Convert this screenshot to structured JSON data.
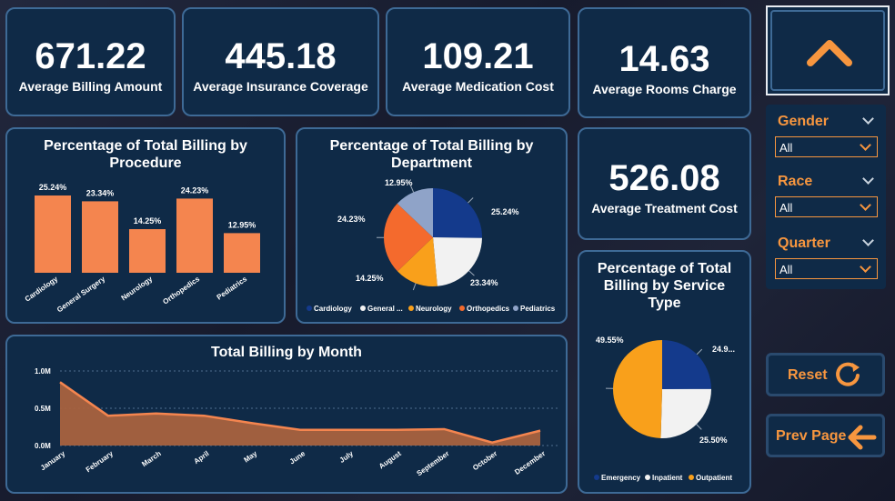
{
  "kpis": {
    "billing": {
      "value": "671.22",
      "label": "Average Billing Amount"
    },
    "insurance": {
      "value": "445.18",
      "label": "Average Insurance Coverage"
    },
    "medication": {
      "value": "109.21",
      "label": "Average Medication Cost"
    },
    "rooms": {
      "value": "14.63",
      "label": "Average Rooms Charge"
    },
    "treatment": {
      "value": "526.08",
      "label": "Average Treatment Cost"
    }
  },
  "slicers": {
    "gender": {
      "label": "Gender",
      "value": "All"
    },
    "race": {
      "label": "Race",
      "value": "All"
    },
    "quarter": {
      "label": "Quarter",
      "value": "All"
    }
  },
  "buttons": {
    "reset": "Reset",
    "prev": "Prev Page"
  },
  "colors": {
    "accent": "#f7963f",
    "card_bg": "#0f2a47",
    "bar": "#f4854f"
  },
  "chart_data": [
    {
      "id": "procedure",
      "type": "bar",
      "title": "Percentage of Total Billing by Procedure",
      "categories": [
        "Cardiology",
        "General Surgery",
        "Neurology",
        "Orthopedics",
        "Pediatrics"
      ],
      "values": [
        25.24,
        23.34,
        14.25,
        24.23,
        12.95
      ],
      "value_labels": [
        "25.24%",
        "23.34%",
        "14.25%",
        "24.23%",
        "12.95%"
      ],
      "ylim": [
        0,
        30
      ],
      "grid": false
    },
    {
      "id": "department",
      "type": "pie",
      "title": "Percentage of Total Billing by Department",
      "categories": [
        "Cardiology",
        "General ...",
        "Neurology",
        "Orthopedics",
        "Pediatrics"
      ],
      "values": [
        25.24,
        23.34,
        14.25,
        24.23,
        12.95
      ],
      "value_labels": [
        "25.24%",
        "23.34%",
        "14.25%",
        "24.23%",
        "12.95%"
      ],
      "colors": [
        "#143a8c",
        "#f2f2f2",
        "#f9a01b",
        "#f46a2d",
        "#8fa3c8"
      ],
      "legend": "bottom"
    },
    {
      "id": "service",
      "type": "pie",
      "title": "Percentage of Total Billing by Service Type",
      "categories": [
        "Emergency",
        "Inpatient",
        "Outpatient"
      ],
      "values": [
        24.95,
        25.5,
        49.55
      ],
      "value_labels": [
        "24.9...",
        "25.50%",
        "49.55%"
      ],
      "colors": [
        "#143a8c",
        "#f2f2f2",
        "#f9a01b"
      ],
      "legend": "bottom"
    },
    {
      "id": "month",
      "type": "area",
      "title": "Total Billing by Month",
      "categories": [
        "January",
        "February",
        "March",
        "April",
        "May",
        "June",
        "July",
        "August",
        "September",
        "October",
        "December"
      ],
      "values": [
        0.85,
        0.4,
        0.43,
        0.4,
        0.3,
        0.21,
        0.21,
        0.21,
        0.22,
        0.04,
        0.2
      ],
      "yticks": [
        "1.0M",
        "0.5M",
        "0.0M"
      ],
      "ylim": [
        0,
        1.0
      ],
      "grid": true
    }
  ]
}
